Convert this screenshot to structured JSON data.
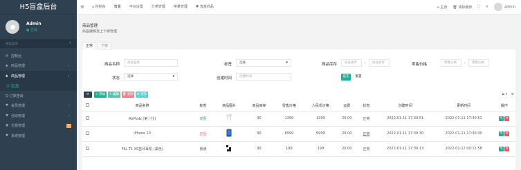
{
  "app": {
    "title": "H5盲盒后台"
  },
  "user": {
    "name": "Admin",
    "status": "● 在线"
  },
  "sidebar": {
    "search_placeholder": "搜索菜单",
    "search_icon": "search-icon",
    "items": [
      {
        "icon": "◍",
        "label": "控制台",
        "state": "normal"
      },
      {
        "icon": "▲",
        "label": "商品管理",
        "state": "normal",
        "chevron": "⌄"
      },
      {
        "icon": "▲",
        "label": "商品管理",
        "state": "active-parent",
        "chevron": "⌄"
      },
      {
        "icon": "",
        "label": "O 盲盒",
        "state": "active-child"
      },
      {
        "icon": "",
        "label": "Q 订单查询",
        "state": "normal"
      },
      {
        "icon": "♥",
        "label": "会员管理",
        "state": "normal",
        "chevron": "‹"
      },
      {
        "icon": "♥",
        "label": "活动管理",
        "state": "normal",
        "chevron": "‹"
      },
      {
        "icon": "▣",
        "label": "交易管理",
        "state": "normal",
        "badge": "?"
      },
      {
        "icon": "♥",
        "label": "系统管理",
        "state": "normal"
      }
    ]
  },
  "topbar": {
    "menu_toggle": "≡",
    "tabs": [
      {
        "label": "⌂ 控制台",
        "active": false
      },
      {
        "label": "盲盒",
        "active": true
      },
      {
        "label": "平台设置",
        "active": false
      },
      {
        "label": "分类管理",
        "active": false
      },
      {
        "label": "常量管理",
        "active": false
      },
      {
        "label": "♥ 盲盒商品",
        "active": false
      }
    ],
    "right": {
      "home": "⌂ 主页",
      "clear_cache": "🗑 清除缓存",
      "fullscreen": "⛶",
      "expand": "✕",
      "admin": "Admin"
    }
  },
  "page": {
    "title": "商品管理",
    "desc": "商品编辑及上下架管理",
    "tabs": [
      {
        "label": "正常",
        "active": true
      },
      {
        "label": "下架",
        "active": false
      }
    ]
  },
  "filters": {
    "name_label": "商品名称",
    "name_placeholder": "商品名称",
    "tag_label": "标签",
    "tag_value": "选择",
    "stock_label": "商品库存",
    "stock_min_placeholder": "商品库存",
    "stock_max_placeholder": "商品库存",
    "stock_sep": "-",
    "price_label": "零售价格",
    "price_min_placeholder": "零售价格",
    "price_max_placeholder": "零售价格",
    "price_sep": "-",
    "status_label": "状态",
    "status_value": "选择",
    "created_label": "创建时间",
    "created_placeholder": "创建时间",
    "submit": "提交",
    "reset": "重置"
  },
  "toolbar": {
    "refresh": "⟳",
    "add": "+ 添加",
    "edit": "✎ 编辑",
    "delete": "🗑 删除",
    "more": "⚙ 更多",
    "columns": "⇊ ▾",
    "right_icon": "⟳"
  },
  "table": {
    "headers": [
      "商品名称",
      "标签",
      "商品图片",
      "商品库存",
      "零售价格",
      "人民币价格",
      "运费",
      "状态",
      "创建时间",
      "更新时间",
      "操作"
    ],
    "rows": [
      {
        "name": "AirPods (第一代)",
        "tag": "优惠",
        "tag_color": "green",
        "thumb": "airpods",
        "stock": "90",
        "retail": "1399",
        "rmb": "1399",
        "freight": "20.00",
        "status": "正常",
        "status_style": "normal",
        "created": "2022-01-11 17:30:51",
        "updated": "2022-01-11 17:30:51"
      },
      {
        "name": "iPhone 13",
        "tag": "正品",
        "tag_color": "red",
        "thumb": "iphone",
        "stock": "90",
        "retail": "6999",
        "rmb": "6999",
        "freight": "20.00",
        "status": "正常",
        "status_style": "underline",
        "created": "2022-01-11 17:30:30",
        "updated": "2022-01-11 17:30:30"
      },
      {
        "name": "FIIL T1 XS蓝牙耳机 (黑色)",
        "tag": "普通",
        "tag_color": "normal",
        "thumb": "earbuds",
        "stock": "90",
        "retail": "199",
        "rmb": "199",
        "freight": "20.00",
        "status": "正常",
        "status_style": "normal",
        "created": "2022-01-11 17:30:13",
        "updated": "2022-01-12 00:11:58"
      }
    ]
  },
  "colors": {
    "sidebar_bg": "#2f4050",
    "accent_green": "#1ab394",
    "danger_red": "#ed5565",
    "warn_yellow": "#f8ac59",
    "primary_blue": "#1c84c6",
    "dark_btn": "#2f4050"
  }
}
